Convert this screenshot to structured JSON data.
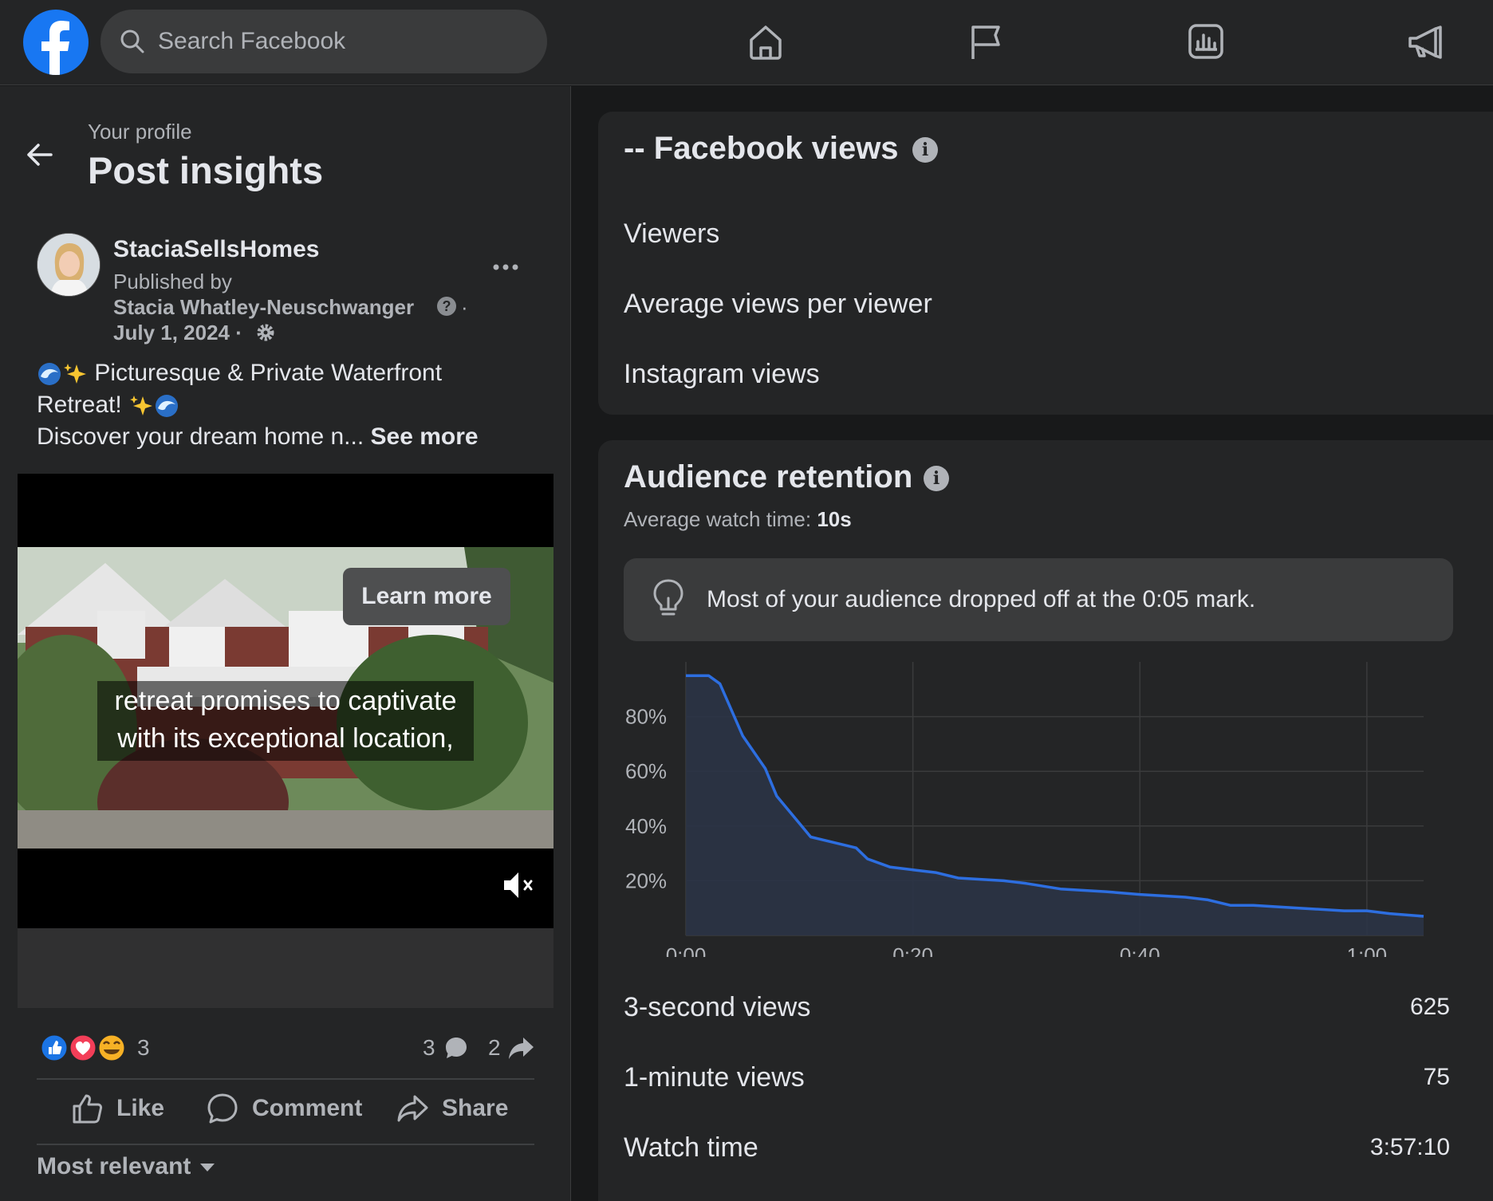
{
  "header": {
    "search_placeholder": "Search Facebook",
    "nav_icons": [
      "home-icon",
      "flag-icon",
      "insights-icon",
      "megaphone-icon"
    ],
    "brand_color": "#1877f2"
  },
  "left": {
    "breadcrumb": "Your profile",
    "title": "Post insights",
    "post": {
      "author": "StaciaSellsHomes",
      "published_by_label": "Published by",
      "published_by": "Stacia Whatley-Neuschwanger",
      "date": "July 1, 2024",
      "text_line1": "Picturesque & Private Waterfront",
      "text_line2": "Retreat!",
      "text_line3": "Discover your dream home n...",
      "see_more": "See more",
      "video_caption": "retreat promises to captivate with its exceptional location,",
      "cta_label": "Learn more",
      "reaction_count": "3",
      "comment_count": "3",
      "share_count": "2",
      "actions": {
        "like": "Like",
        "comment": "Comment",
        "share": "Share"
      },
      "sort_label": "Most relevant"
    }
  },
  "facebook_views": {
    "title": "-- Facebook views",
    "rows": [
      "Viewers",
      "Average views per viewer",
      "Instagram views"
    ]
  },
  "audience_retention": {
    "title": "Audience retention",
    "avg_watch_label": "Average watch time:",
    "avg_watch_value": "10s",
    "tip": "Most of your audience dropped off at the 0:05 mark.",
    "metrics": [
      {
        "label": "3-second views",
        "value": "625"
      },
      {
        "label": "1-minute views",
        "value": "75"
      },
      {
        "label": "Watch time",
        "value": "3:57:10"
      }
    ]
  },
  "chart_data": {
    "type": "area",
    "x_tick_labels": [
      "0:00",
      "0:20",
      "0:40",
      "1:00"
    ],
    "y_tick_labels": [
      "80%",
      "60%",
      "40%",
      "20%"
    ],
    "xlim": [
      0,
      65
    ],
    "ylim": [
      0,
      100
    ],
    "color": "#2d6ee0",
    "x": [
      0,
      2,
      3,
      5,
      7,
      8,
      10,
      11,
      12,
      15,
      16,
      18,
      20,
      22,
      24,
      28,
      30,
      33,
      37,
      40,
      44,
      46,
      48,
      50,
      54,
      58,
      60,
      62,
      65
    ],
    "y": [
      95,
      95,
      92,
      73,
      61,
      51,
      41,
      36,
      35,
      32,
      28,
      25,
      24,
      23,
      21,
      20,
      19,
      17,
      16,
      15,
      14,
      13,
      11,
      11,
      10,
      9,
      9,
      8,
      7
    ]
  }
}
